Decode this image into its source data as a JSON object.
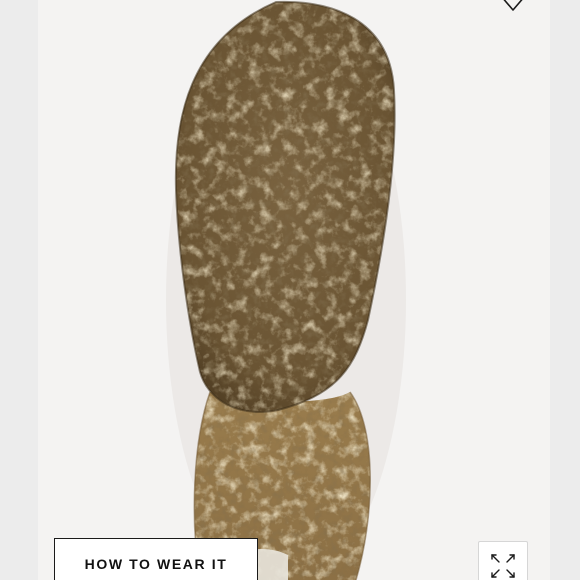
{
  "product": {
    "image_description_icon": "crepe-sole-image"
  },
  "actions": {
    "favorite_icon": "heart-icon",
    "how_to_wear_label": "HOW TO WEAR IT",
    "zoom_icon": "expand-icon"
  },
  "colors": {
    "background": "#f4f3f2",
    "sole_outer": "#6b5533",
    "sole_heel": "#8f7448",
    "button_border": "#1a1a1a"
  }
}
